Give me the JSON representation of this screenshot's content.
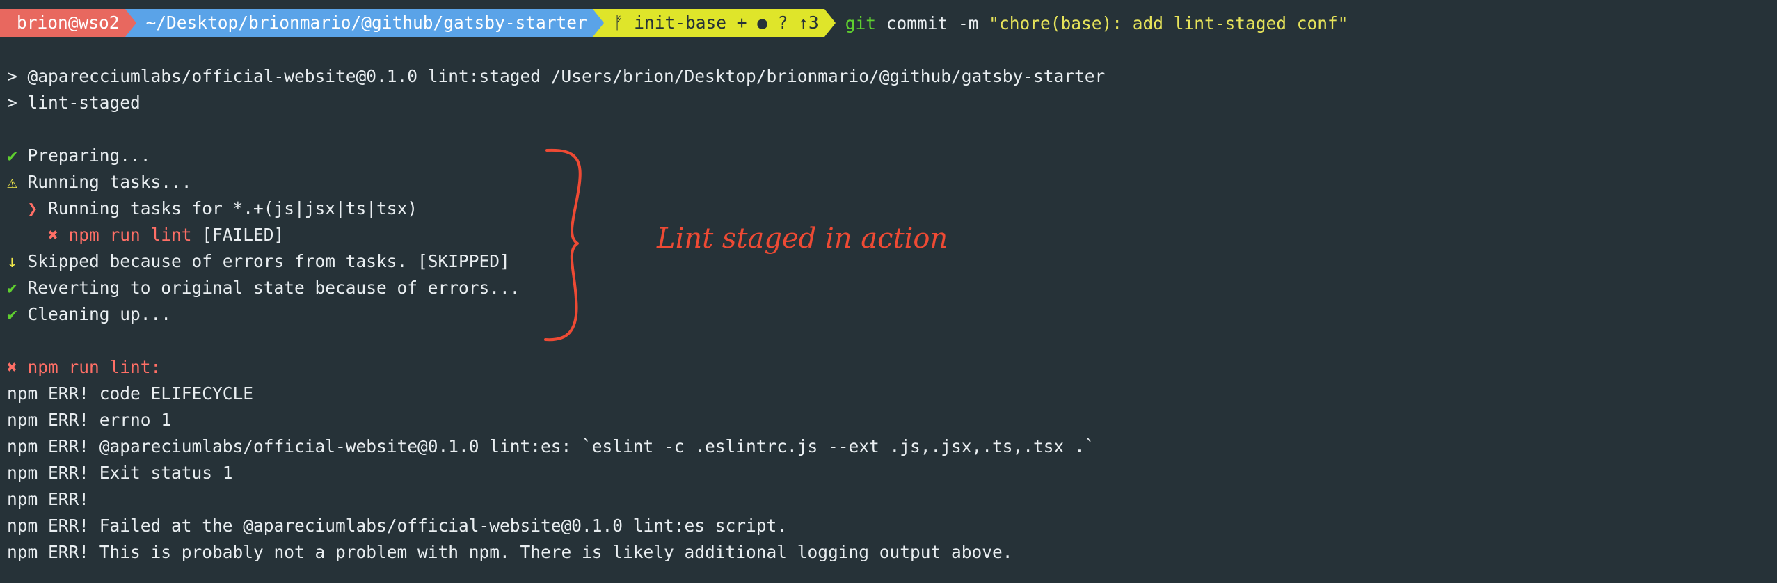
{
  "prompt": {
    "user": "brion@wso2",
    "path": "~/Desktop/brionmario/@github/gatsby-starter",
    "git_branch": "ᚠ init-base + ● ? ↑3",
    "command_keyword": "git",
    "command_args": " commit -m ",
    "command_message": "\"chore(base): add lint-staged conf\""
  },
  "output": {
    "run_line": "> @aparecciumlabs/official-website@0.1.0 lint:staged /Users/brion/Desktop/brionmario/@github/gatsby-starter",
    "run_line2": "> lint-staged",
    "tasks": [
      {
        "icon": "✔",
        "text": " Preparing..."
      },
      {
        "icon": "⚠",
        "text": " Running tasks..."
      },
      {
        "icon": "  ❯",
        "text": " Running tasks for *.+(js|jsx|ts|tsx)"
      },
      {
        "icon": "    ✖",
        "text": " npm run lint",
        "suffix": " [FAILED]"
      },
      {
        "icon": "↓",
        "text": " Skipped because of errors from tasks. [SKIPPED]"
      },
      {
        "icon": "✔",
        "text": " Reverting to original state because of errors..."
      },
      {
        "icon": "✔",
        "text": " Cleaning up..."
      }
    ],
    "error_header": "✖ npm run lint:",
    "errors": [
      "npm ERR! code ELIFECYCLE",
      "npm ERR! errno 1",
      "npm ERR! @apareciumlabs/official-website@0.1.0 lint:es: `eslint -c .eslintrc.js --ext .js,.jsx,.ts,.tsx .`",
      "npm ERR! Exit status 1",
      "npm ERR!",
      "npm ERR! Failed at the @apareciumlabs/official-website@0.1.0 lint:es script.",
      "npm ERR! This is probably not a problem with npm. There is likely additional logging output above."
    ]
  },
  "annotation": "Lint staged in action",
  "colors": {
    "background": "#263238",
    "user_segment": "#e8685f",
    "path_segment": "#5aa3e8",
    "git_segment": "#dfe52a",
    "annotation": "#ee4a34"
  }
}
